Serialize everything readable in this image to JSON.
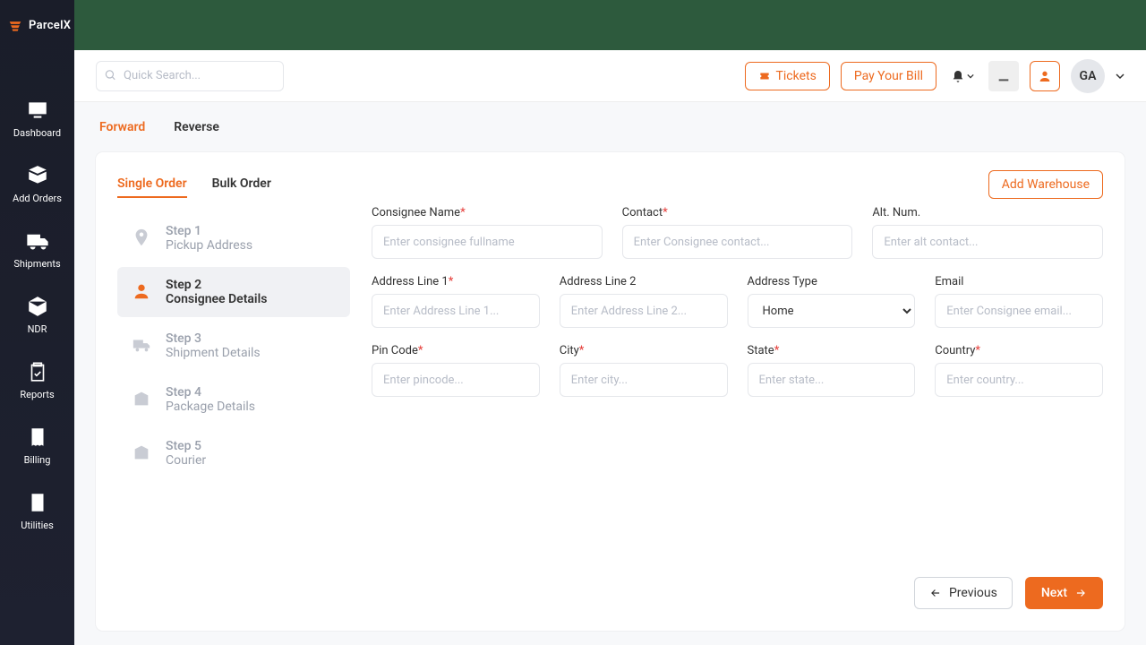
{
  "brand": "ParcelX",
  "search": {
    "placeholder": "Quick Search..."
  },
  "topbar": {
    "tickets": "Tickets",
    "pay": "Pay Your Bill",
    "avatar": "GA"
  },
  "nav": {
    "dashboard": "Dashboard",
    "add": "Add Orders",
    "ship": "Shipments",
    "ndr": "NDR",
    "reports": "Reports",
    "billing": "Billing",
    "utilities": "Utilities"
  },
  "modes": {
    "forward": "Forward",
    "reverse": "Reverse"
  },
  "card": {
    "single": "Single Order",
    "bulk": "Bulk Order",
    "addwh": "Add Warehouse"
  },
  "steps": [
    {
      "n": "Step 1",
      "d": "Pickup Address"
    },
    {
      "n": "Step 2",
      "d": "Consignee Details"
    },
    {
      "n": "Step 3",
      "d": "Shipment Details"
    },
    {
      "n": "Step 4",
      "d": "Package Details"
    },
    {
      "n": "Step 5",
      "d": "Courier"
    }
  ],
  "form": {
    "name": {
      "label": "Consignee Name",
      "ph": "Enter consignee fullname"
    },
    "contact": {
      "label": "Contact",
      "ph": "Enter Consignee contact..."
    },
    "alt": {
      "label": "Alt. Num.",
      "ph": "Enter alt contact..."
    },
    "a1": {
      "label": "Address Line 1",
      "ph": "Enter Address Line 1..."
    },
    "a2": {
      "label": "Address Line 2",
      "ph": "Enter Address Line 2..."
    },
    "atype": {
      "label": "Address Type",
      "selected": "Home"
    },
    "email": {
      "label": "Email",
      "ph": "Enter Consignee email..."
    },
    "pin": {
      "label": "Pin Code",
      "ph": "Enter pincode..."
    },
    "city": {
      "label": "City",
      "ph": "Enter city..."
    },
    "state": {
      "label": "State",
      "ph": "Enter state..."
    },
    "country": {
      "label": "Country",
      "ph": "Enter country..."
    }
  },
  "footer": {
    "prev": "Previous",
    "next": "Next"
  }
}
